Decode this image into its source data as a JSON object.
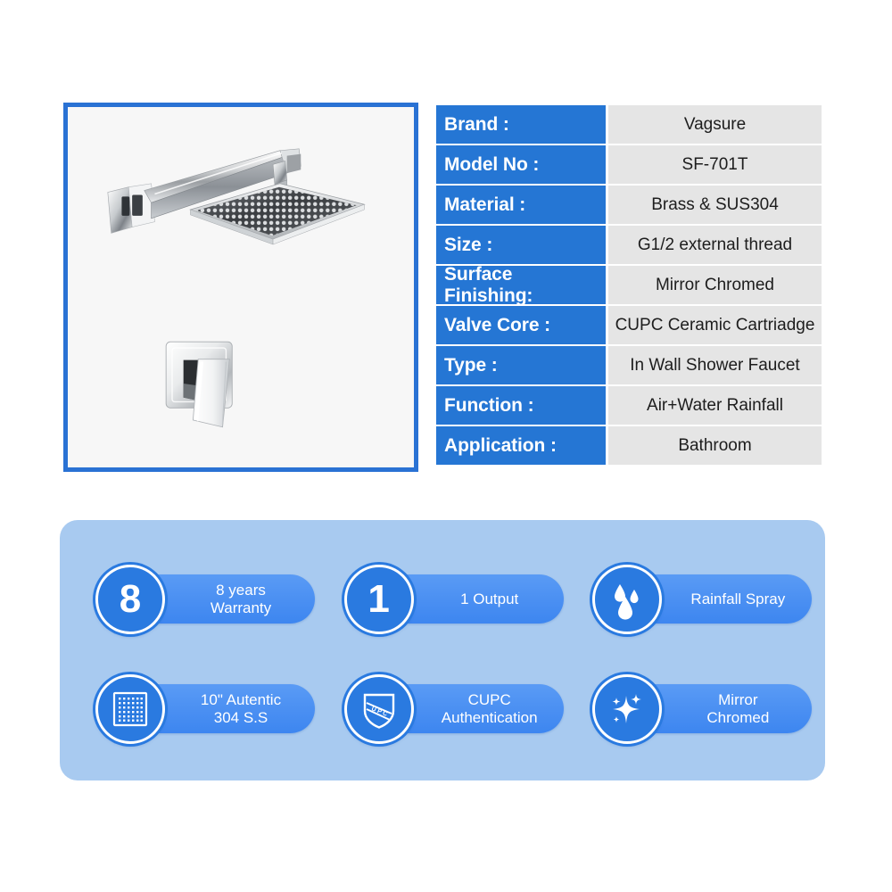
{
  "product_image": {
    "alt": "Wall mounted square rainfall shower head with arm and concealed mixer valve handle",
    "border_color": "#2a72d4",
    "background": "#f7f7f7",
    "parts": [
      "shower-arm",
      "square-shower-head",
      "wall-flange",
      "mixer-valve-handle"
    ]
  },
  "spec_table": {
    "label_bg": "#2576d4",
    "label_color": "#ffffff",
    "value_bg": "#e5e5e5",
    "rows": [
      {
        "label": "Brand :",
        "value": "Vagsure"
      },
      {
        "label": "Model No :",
        "value": "SF-701T"
      },
      {
        "label": "Material :",
        "value": "Brass & SUS304"
      },
      {
        "label": "Size :",
        "value": "G1/2 external thread"
      },
      {
        "label": "Surface Finishing:",
        "value": "Mirror Chromed"
      },
      {
        "label": "Valve Core :",
        "value": "CUPC Ceramic Cartriadge"
      },
      {
        "label": "Type :",
        "value": "In Wall Shower Faucet"
      },
      {
        "label": "Function :",
        "value": "Air+Water Rainfall"
      },
      {
        "label": "Application :",
        "value": "Bathroom"
      }
    ]
  },
  "feature_panel": {
    "background": "#a8caf0",
    "pill_color": "#4a8ff2",
    "circle_color": "#2a7ae0",
    "badges": [
      {
        "icon": "numeral-8-icon",
        "numeral": "8",
        "text": "8 years\nWarranty"
      },
      {
        "icon": "numeral-1-icon",
        "numeral": "1",
        "text": "1 Output"
      },
      {
        "icon": "water-droplets-icon",
        "numeral": "",
        "text": "Rainfall Spray"
      },
      {
        "icon": "shower-head-grid-icon",
        "numeral": "",
        "text": "10\" Autentic\n304 S.S"
      },
      {
        "icon": "upc-shield-icon",
        "numeral": "",
        "text": "CUPC\nAuthentication"
      },
      {
        "icon": "sparkle-shine-icon",
        "numeral": "",
        "text": "Mirror\nChromed"
      }
    ]
  }
}
